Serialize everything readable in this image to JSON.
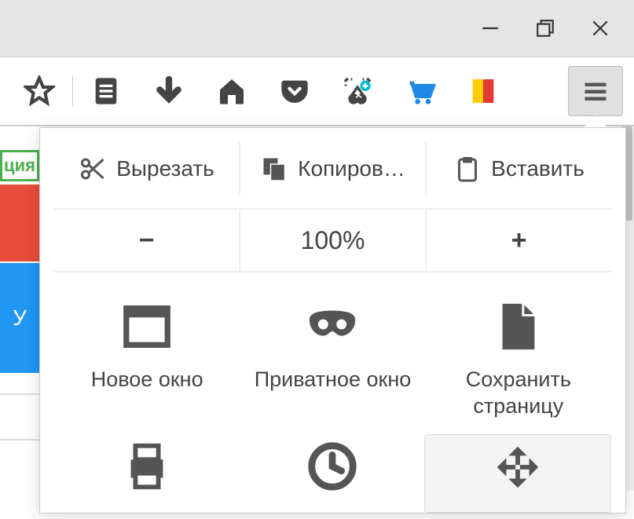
{
  "window": {
    "minimize": "−",
    "maximize": "❐",
    "close": "✕"
  },
  "toolbar": {
    "items": [
      "bookmark-star",
      "list",
      "download",
      "home",
      "pocket",
      "screenshot",
      "cart",
      "flag"
    ]
  },
  "menu": {
    "cut": "Вырезать",
    "copy": "Копиров…",
    "paste": "Вставить",
    "zoom_out": "−",
    "zoom_level": "100%",
    "zoom_in": "+",
    "grid": [
      {
        "id": "new-window",
        "label": "Новое окно"
      },
      {
        "id": "private-window",
        "label": "Приватное окно"
      },
      {
        "id": "save-page",
        "label": "Сохранить страницу"
      },
      {
        "id": "print",
        "label": ""
      },
      {
        "id": "history",
        "label": ""
      },
      {
        "id": "fullscreen",
        "label": ""
      }
    ]
  },
  "page_bg": {
    "green_text": "ция",
    "blue_text": "У"
  }
}
